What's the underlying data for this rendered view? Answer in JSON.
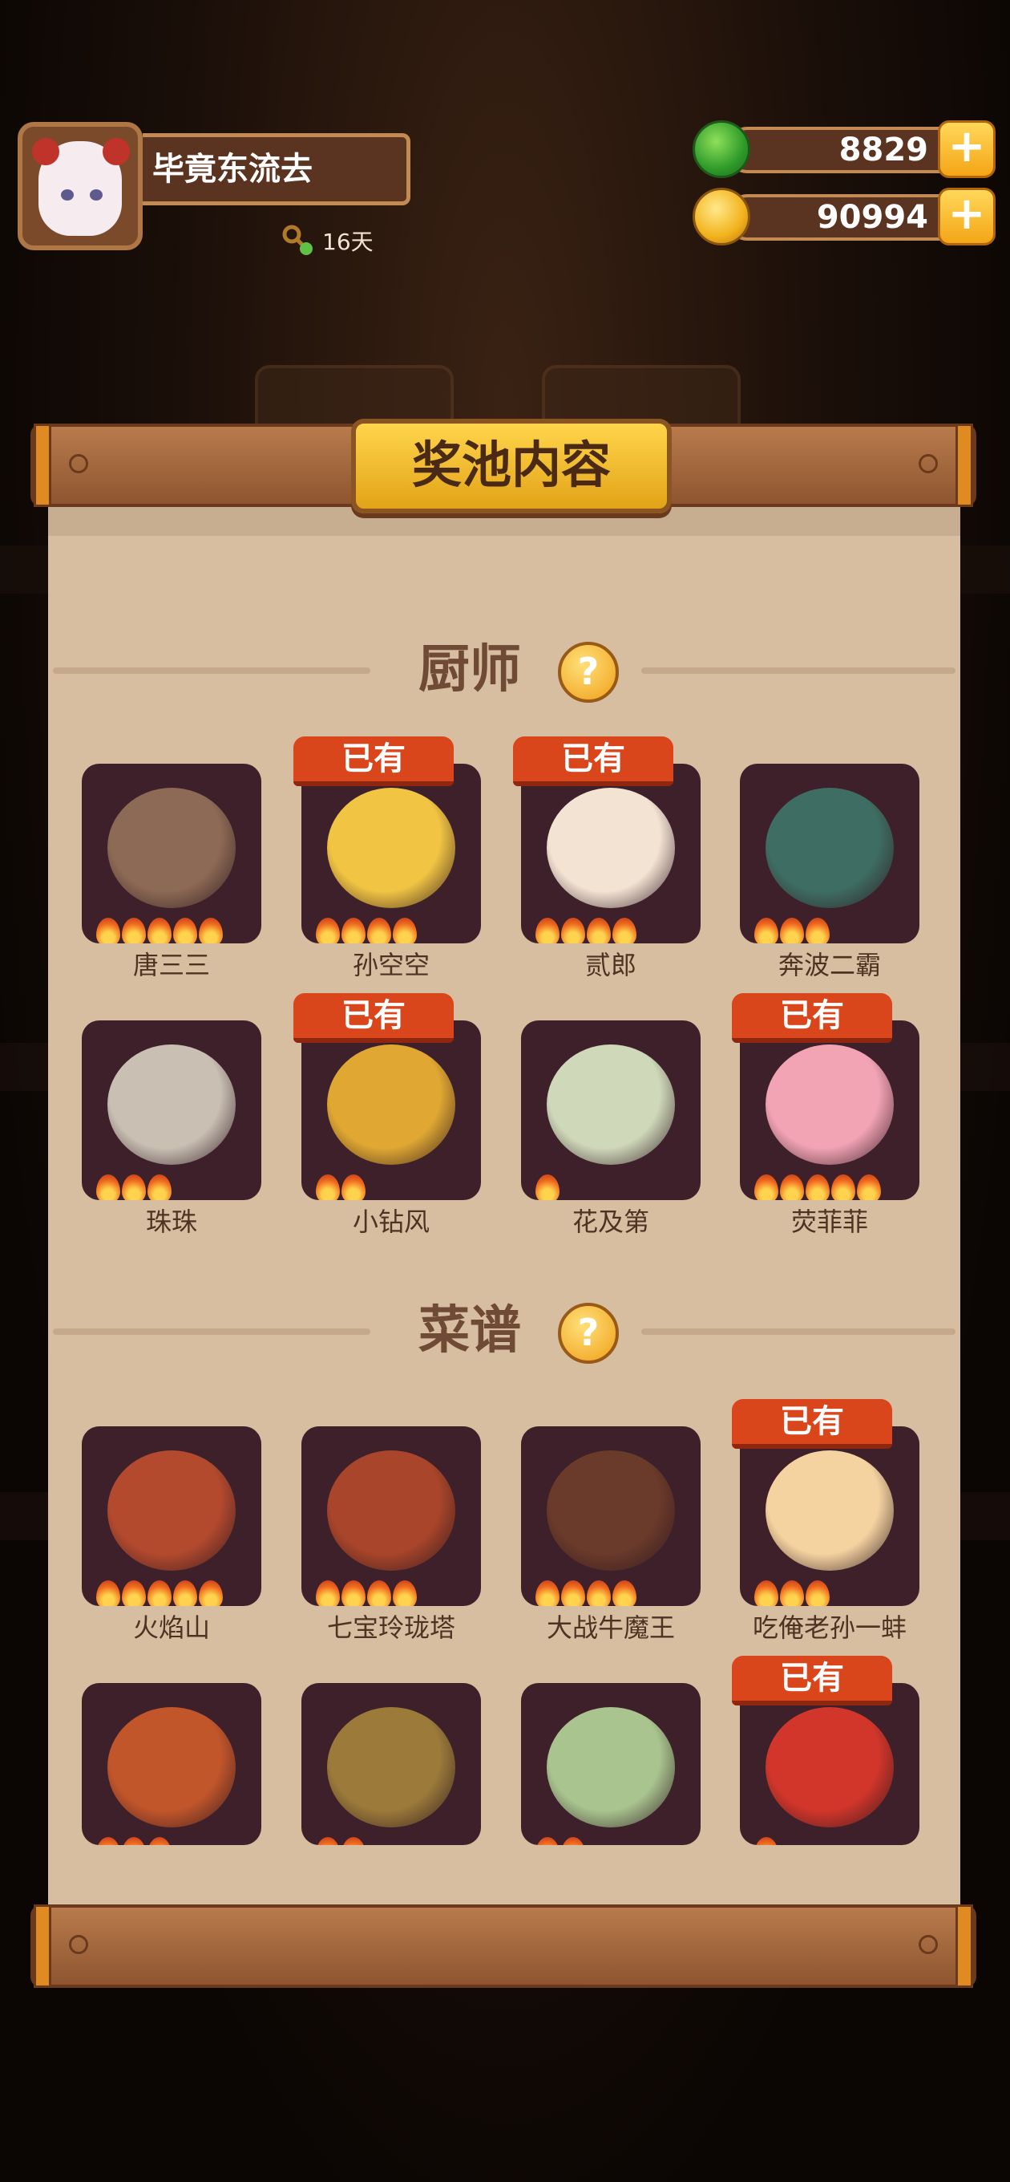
{
  "player": {
    "name": "毕竟东流去",
    "login_days": "16天"
  },
  "currency": {
    "jade": "8829",
    "coins": "90994"
  },
  "panel": {
    "title": "奖池内容"
  },
  "sections": {
    "chefs_title": "厨师",
    "recipes_title": "菜谱",
    "help_glyph": "?"
  },
  "owned_label": "已有",
  "chefs": [
    {
      "name": "唐三三",
      "stars": 5,
      "owned": false,
      "color": "#8d6a55"
    },
    {
      "name": "孙空空",
      "stars": 4,
      "owned": true,
      "color": "#f1c443"
    },
    {
      "name": "贰郎",
      "stars": 4,
      "owned": true,
      "color": "#f3e3d3"
    },
    {
      "name": "奔波二霸",
      "stars": 3,
      "owned": false,
      "color": "#3e6e63"
    },
    {
      "name": "珠珠",
      "stars": 3,
      "owned": false,
      "color": "#c9bfb3"
    },
    {
      "name": "小钻风",
      "stars": 2,
      "owned": true,
      "color": "#e0a832"
    },
    {
      "name": "花及第",
      "stars": 1,
      "owned": false,
      "color": "#cfd8b9"
    },
    {
      "name": "荧菲菲",
      "stars": 5,
      "owned": true,
      "color": "#f2a3b4"
    }
  ],
  "recipes": [
    {
      "name": "火焰山",
      "stars": 5,
      "owned": false,
      "color": "#b34a2e"
    },
    {
      "name": "七宝玲珑塔",
      "stars": 4,
      "owned": false,
      "color": "#a8452a"
    },
    {
      "name": "大战牛魔王",
      "stars": 4,
      "owned": false,
      "color": "#6a3a2a"
    },
    {
      "name": "吃俺老孙一蚌",
      "stars": 3,
      "owned": true,
      "color": "#f5d3a0"
    },
    {
      "name": "",
      "stars": 3,
      "owned": false,
      "color": "#c2562b"
    },
    {
      "name": "",
      "stars": 2,
      "owned": false,
      "color": "#9c7a3a"
    },
    {
      "name": "",
      "stars": 2,
      "owned": false,
      "color": "#a9c48f"
    },
    {
      "name": "",
      "stars": 1,
      "owned": true,
      "color": "#d2362a"
    }
  ]
}
